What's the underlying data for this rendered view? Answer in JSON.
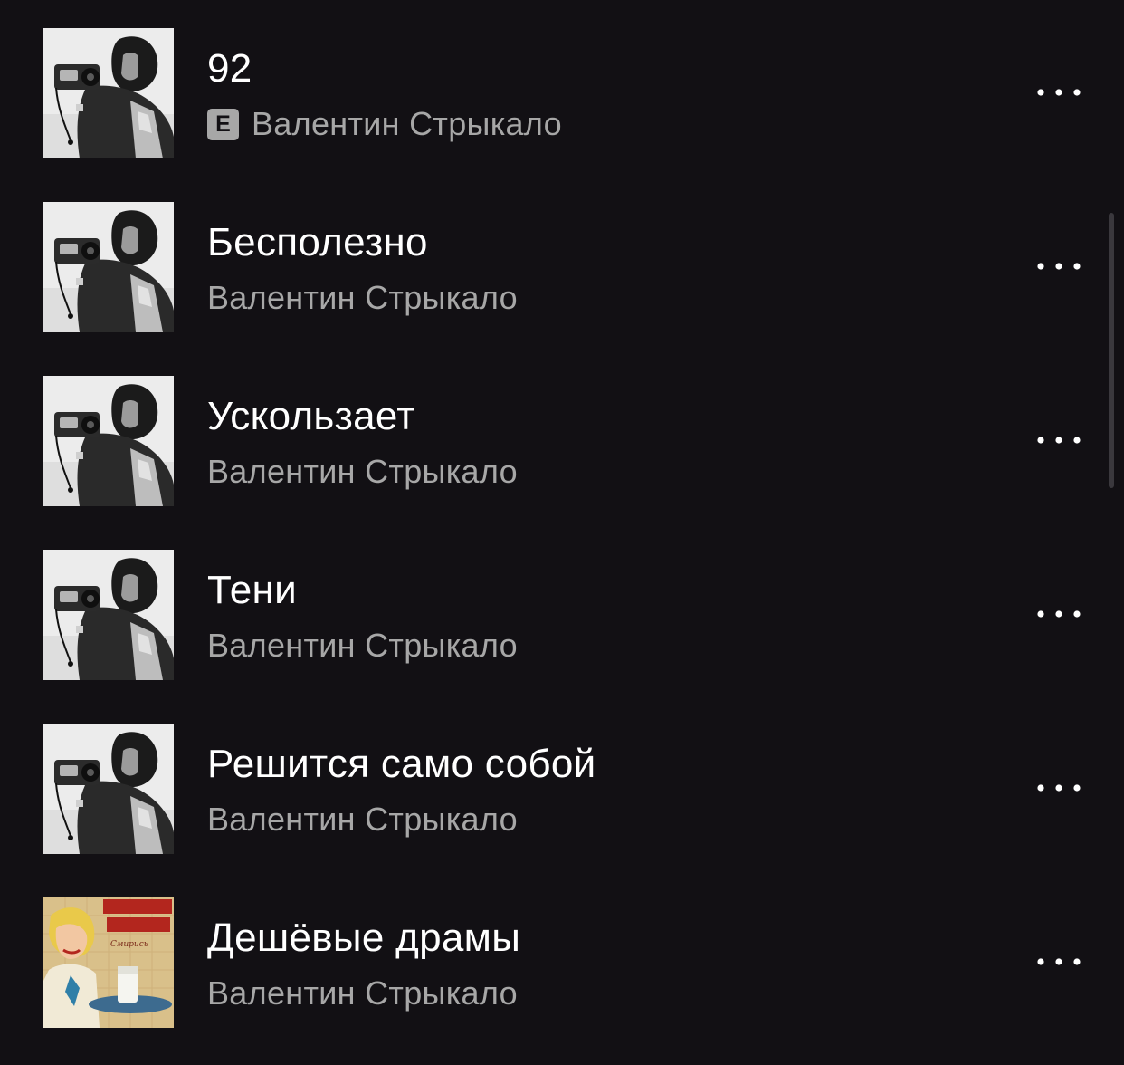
{
  "tracks": [
    {
      "title": "92",
      "artist": "Валентин Стрыкало",
      "explicit": true,
      "explicit_label": "E",
      "cover": "photographer-portrait"
    },
    {
      "title": "Бесполезно",
      "artist": "Валентин Стрыкало",
      "explicit": false,
      "cover": "photographer-portrait"
    },
    {
      "title": "Ускользает",
      "artist": "Валентин Стрыкало",
      "explicit": false,
      "cover": "photographer-portrait"
    },
    {
      "title": "Тени",
      "artist": "Валентин Стрыкало",
      "explicit": false,
      "cover": "photographer-portrait"
    },
    {
      "title": "Решится само собой",
      "artist": "Валентин Стрыкало",
      "explicit": false,
      "cover": "photographer-portrait"
    },
    {
      "title": "Дешёвые драмы",
      "artist": "Валентин Стрыкало",
      "explicit": false,
      "cover": "retro-poster-waitress"
    }
  ],
  "icons": {
    "more": "more-horizontal-icon"
  },
  "colors": {
    "background": "#121014",
    "title": "#ffffff",
    "subtitle": "#a7a7a7"
  }
}
